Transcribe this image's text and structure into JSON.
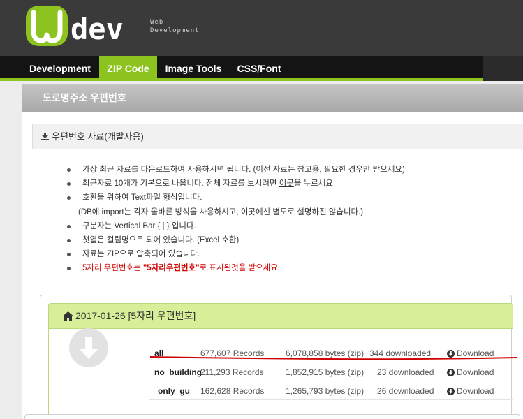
{
  "site": {
    "logo_text": "dev",
    "tagline_1": "Web",
    "tagline_2": "Development"
  },
  "nav": {
    "items": [
      {
        "label": "Development",
        "active": false
      },
      {
        "label": "ZIP Code",
        "active": true
      },
      {
        "label": "Image Tools",
        "active": false
      },
      {
        "label": "CSS/Font",
        "active": false
      }
    ]
  },
  "page_title": "도로명주소 우편번호",
  "section": {
    "title": "우편번호 자료(개발자용)",
    "icon": "download-icon"
  },
  "info": {
    "l1": "가장 최근 자료를 다운로드하여 사용하시면 됩니다. (이전 자료는 참고용, 필요한 경우만 받으세요)",
    "l2a": "최근자료 10개가 기본으로 나옵니다. 전체 자료를 보시려면 ",
    "l2_link": "이곳",
    "l2b": "을 누르세요",
    "l3": "호환을 위하여 Text파일 형식입니다.",
    "l4": "(DB에 import는 각자 올바른 방식을 사용하시고, 이곳에선 별도로 설명하진 않습니다.)",
    "l5": "구분자는 Vertical Bar { | } 입니다.",
    "l6": "첫열은 컬럼명으로 되어 있습니다. (Excel 호환)",
    "l7": "자료는 ZIP으로 압축되어 있습니다.",
    "l8a": "5자리 우편번호는 ",
    "l8_bold": "\"5자리우편번호\"",
    "l8b": "로 표시된것을 받으세요."
  },
  "release": {
    "title": "2017-01-26 [5자리 우편번호]",
    "files": [
      {
        "name": "all",
        "records": "677,607 Records",
        "bytes": "6,078,858 bytes (zip)",
        "downloads": "344 downloaded",
        "action": "Download"
      },
      {
        "name": "no_building",
        "records": "211,293 Records",
        "bytes": "1,852,915 bytes (zip)",
        "downloads": "23 downloaded",
        "action": "Download"
      },
      {
        "name": "only_gu",
        "records": "162,628 Records",
        "bytes": "1,265,793 bytes (zip)",
        "downloads": "26 downloaded",
        "action": "Download"
      }
    ]
  },
  "colors": {
    "accent": "#8cc31e",
    "card_header": "#d8ef99",
    "annotation_red": "#d00000"
  }
}
